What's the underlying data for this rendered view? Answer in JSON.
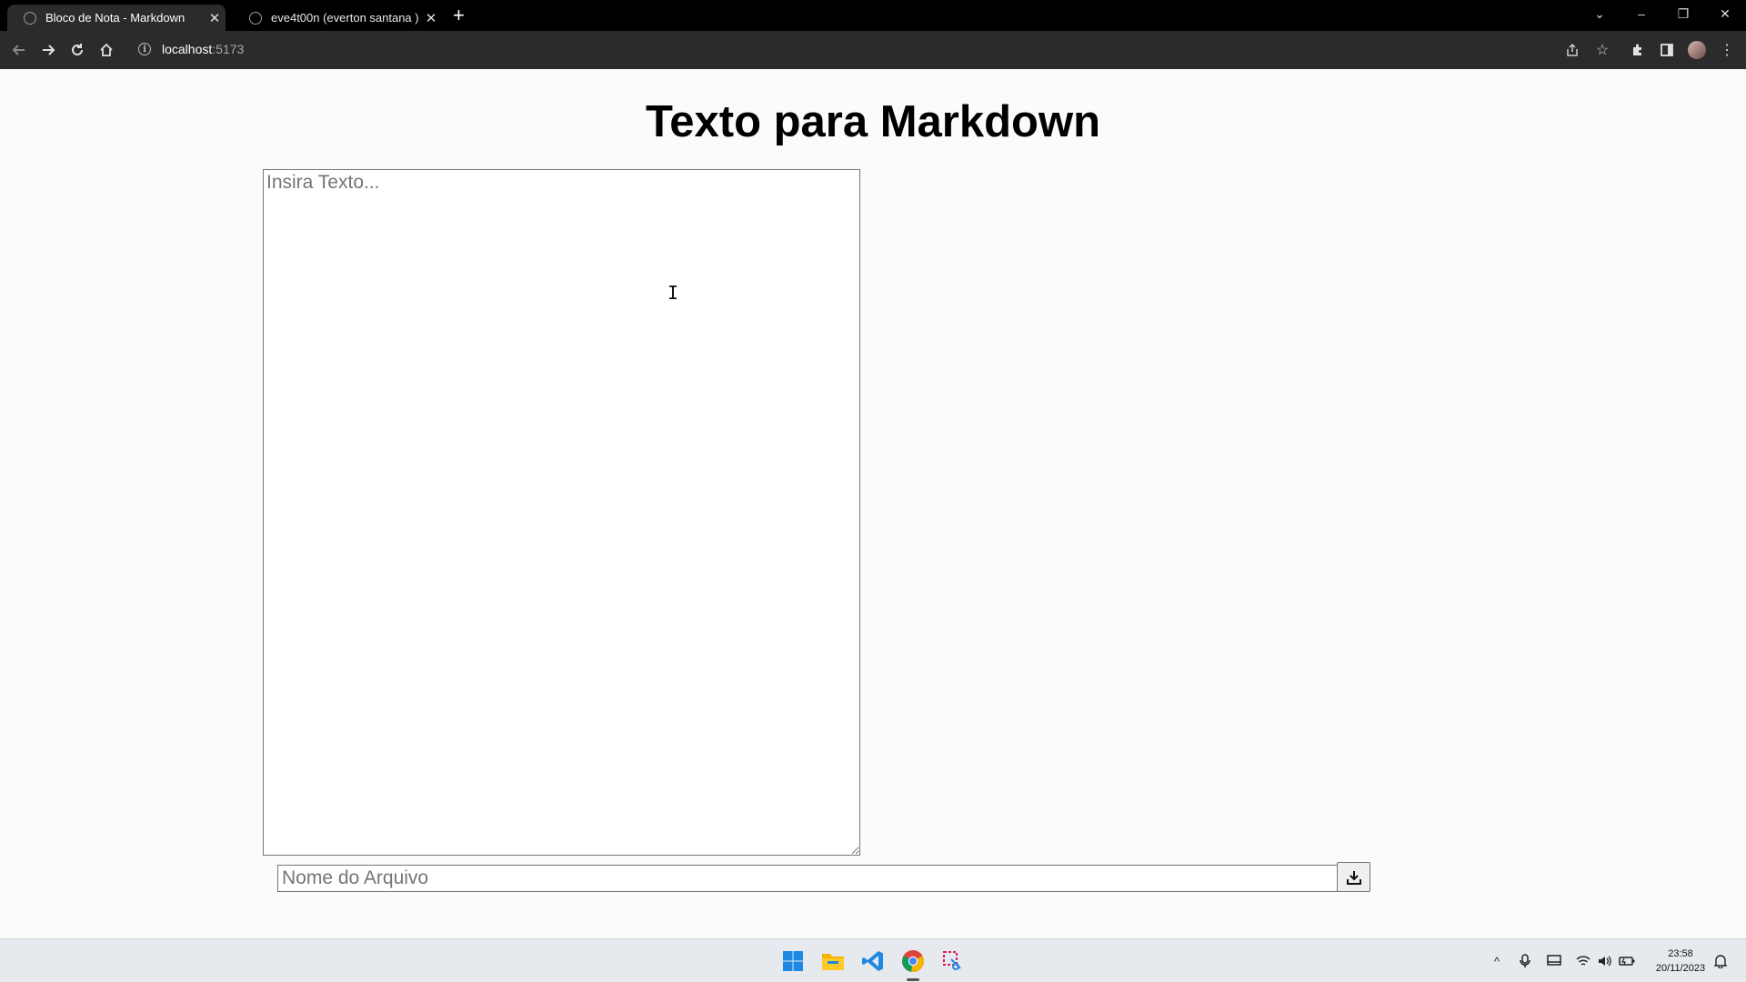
{
  "browser": {
    "tabs": [
      {
        "title": "Bloco de Nota - Markdown",
        "active": true
      },
      {
        "title": "eve4t00n (everton santana )",
        "active": false
      }
    ],
    "new_tab": "+",
    "window_controls": {
      "dropdown": "⌄",
      "minimize": "–",
      "restore": "❐",
      "close": "✕"
    },
    "url_host": "localhost",
    "url_port": ":5173"
  },
  "page": {
    "heading": "Texto para Markdown",
    "text_placeholder": "Insira Texto...",
    "filename_placeholder": "Nome do Arquivo",
    "download_icon": "download-icon"
  },
  "taskbar": {
    "apps": [
      "windows-start-icon",
      "file-explorer-icon",
      "vscode-icon",
      "chrome-icon",
      "snipping-tool-icon"
    ],
    "time": "23:58",
    "date": "20/11/2023"
  },
  "colors": {
    "titlebar": "#000000",
    "toolbar": "#2b2b2b",
    "page_bg": "#fbfbfa",
    "taskbar": "#e6e9ee"
  }
}
